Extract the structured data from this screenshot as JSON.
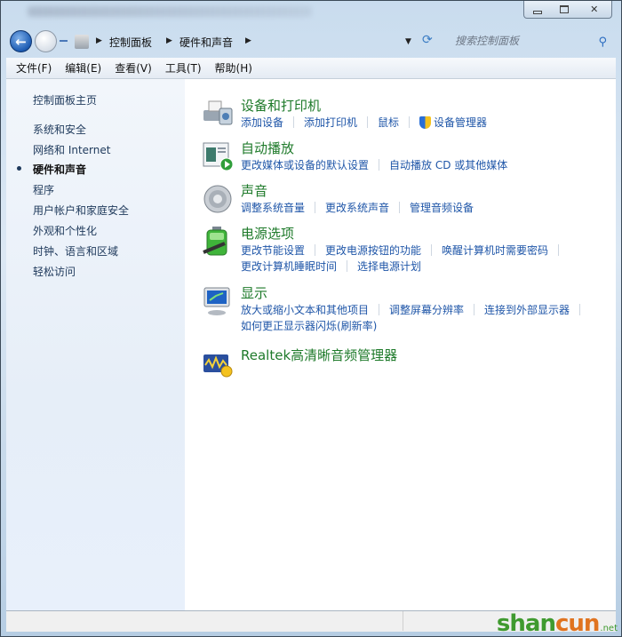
{
  "window": {
    "caption": {
      "minimize": "minimize",
      "maximize": "maximize",
      "close": "✕"
    }
  },
  "address": {
    "crumbs": [
      "控制面板",
      "硬件和声音"
    ],
    "search_placeholder": "搜索控制面板"
  },
  "menu": [
    "文件(F)",
    "编辑(E)",
    "查看(V)",
    "工具(T)",
    "帮助(H)"
  ],
  "sidebar": {
    "home": "控制面板主页",
    "items": [
      {
        "label": "系统和安全",
        "active": false
      },
      {
        "label": "网络和 Internet",
        "active": false
      },
      {
        "label": "硬件和声音",
        "active": true
      },
      {
        "label": "程序",
        "active": false
      },
      {
        "label": "用户帐户和家庭安全",
        "active": false
      },
      {
        "label": "外观和个性化",
        "active": false
      },
      {
        "label": "时钟、语言和区域",
        "active": false
      },
      {
        "label": "轻松访问",
        "active": false
      }
    ]
  },
  "categories": [
    {
      "title": "设备和打印机",
      "icon": "printer-icon",
      "rows": [
        [
          "添加设备",
          "添加打印机",
          "鼠标",
          "设备管理器"
        ]
      ]
    },
    {
      "title": "自动播放",
      "icon": "autoplay-icon",
      "rows": [
        [
          "更改媒体或设备的默认设置",
          "自动播放 CD 或其他媒体"
        ]
      ]
    },
    {
      "title": "声音",
      "icon": "speaker-icon",
      "rows": [
        [
          "调整系统音量",
          "更改系统声音",
          "管理音频设备"
        ]
      ]
    },
    {
      "title": "电源选项",
      "icon": "battery-icon",
      "rows": [
        [
          "更改节能设置",
          "更改电源按钮的功能",
          "唤醒计算机时需要密码"
        ],
        [
          "更改计算机睡眠时间",
          "选择电源计划"
        ]
      ]
    },
    {
      "title": "显示",
      "icon": "monitor-icon",
      "rows": [
        [
          "放大或缩小文本和其他项目",
          "调整屏幕分辨率",
          "连接到外部显示器"
        ],
        [
          "如何更正显示器闪烁(刷新率)"
        ]
      ]
    },
    {
      "title": "Realtek高清晰音频管理器",
      "icon": "realtek-audio-icon",
      "rows": []
    }
  ],
  "watermark": {
    "part1": "shan",
    "part2": "cun",
    "suffix": ".net"
  },
  "colors": {
    "title_green": "#1e7a2a",
    "link_blue": "#1f56a8",
    "sidebar_text": "#1e395b"
  }
}
